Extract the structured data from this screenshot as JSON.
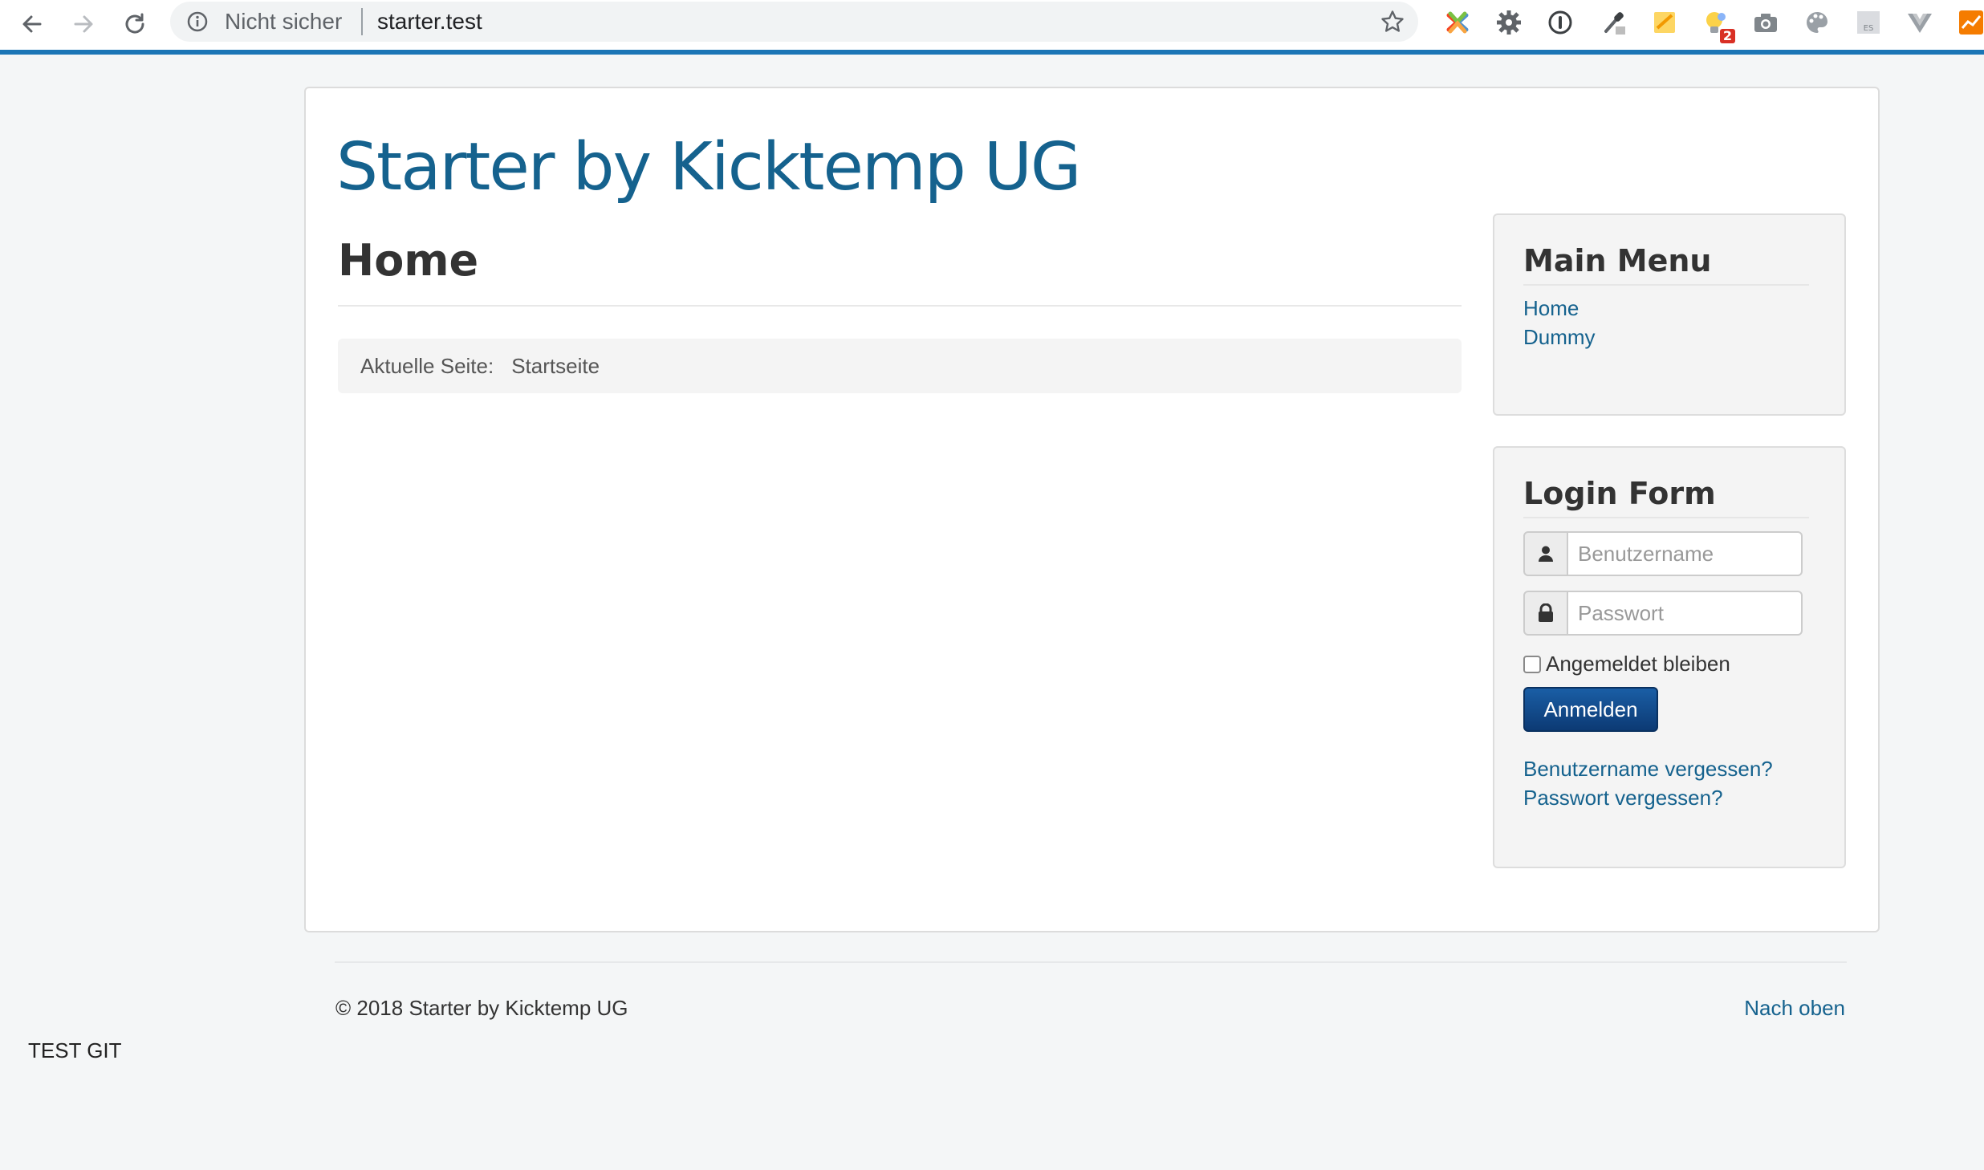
{
  "browser": {
    "security_label": "Nicht sicher",
    "url": "starter.test",
    "extensions": [
      {
        "icon": "joomla-icon"
      },
      {
        "icon": "gear-extension-icon"
      },
      {
        "icon": "password-manager-icon"
      },
      {
        "icon": "eyedropper-icon"
      },
      {
        "icon": "notes-icon"
      },
      {
        "icon": "lightbulb-icon",
        "badge": "2"
      },
      {
        "icon": "camera-icon"
      },
      {
        "icon": "palette-icon"
      },
      {
        "icon": "es-icon",
        "text": "ES"
      },
      {
        "icon": "vue-devtools-icon"
      },
      {
        "icon": "chart-icon"
      }
    ]
  },
  "site": {
    "brand": "Starter by Kicktemp UG",
    "page_title": "Home",
    "breadcrumb": {
      "label": "Aktuelle Seite:",
      "current": "Startseite"
    }
  },
  "main_menu": {
    "title": "Main Menu",
    "items": [
      {
        "label": "Home"
      },
      {
        "label": "Dummy"
      }
    ]
  },
  "login_form": {
    "title": "Login Form",
    "username_placeholder": "Benutzername",
    "password_placeholder": "Passwort",
    "remember_label": "Angemeldet bleiben",
    "submit_label": "Anmelden",
    "forgot_username": "Benutzername vergessen?",
    "forgot_password": "Passwort vergessen?"
  },
  "footer": {
    "copyright": "© 2018 Starter by Kicktemp UG",
    "back_to_top": "Nach oben",
    "debug_text": "TEST GIT"
  },
  "colors": {
    "brand": "#15628e",
    "page_bg": "#f4f6f7",
    "button": "#0c3a74",
    "toolbar_accent": "#1b76b6"
  }
}
